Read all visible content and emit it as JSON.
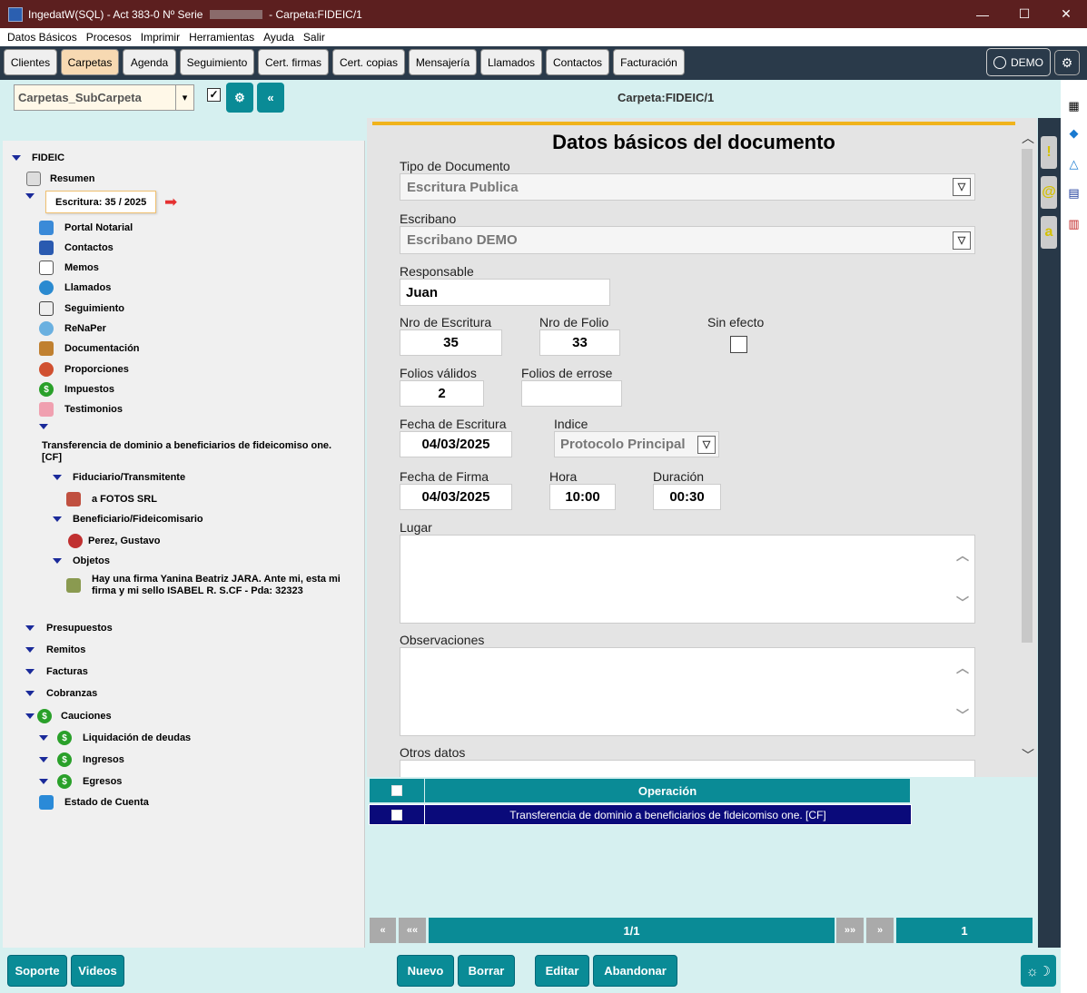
{
  "window": {
    "title_prefix": "IngedatW(SQL) - Act 383-0 Nº Serie",
    "title_suffix": "- Carpeta:FIDEIC/1",
    "controls": {
      "minimize": "—",
      "maximize": "☐",
      "close": "✕"
    }
  },
  "menu": [
    "Datos Básicos",
    "Procesos",
    "Imprimir",
    "Herramientas",
    "Ayuda",
    "Salir"
  ],
  "tabs": [
    {
      "label": "Clientes"
    },
    {
      "label": "Carpetas",
      "active": true
    },
    {
      "label": "Agenda"
    },
    {
      "label": "Seguimiento"
    },
    {
      "label": "Cert. firmas"
    },
    {
      "label": "Cert. copias"
    },
    {
      "label": "Mensajería"
    },
    {
      "label": "Llamados"
    },
    {
      "label": "Contactos"
    },
    {
      "label": "Facturación"
    }
  ],
  "user": {
    "label": "DEMO"
  },
  "toolbar": {
    "subfolder_select": "Carpetas_SubCarpeta",
    "checked": true,
    "collapse_label": "«",
    "folder_title": "Carpeta:FIDEIC/1"
  },
  "tree": {
    "root": "FIDEIC",
    "resumen": "Resumen",
    "escritura": "Escritura: 35 / 2025",
    "items": [
      "Portal Notarial",
      "Contactos",
      "Memos",
      "Llamados",
      "Seguimiento",
      "ReNaPer",
      "Documentación",
      "Proporciones",
      "Impuestos",
      "Testimonios"
    ],
    "operation": "Transferencia de dominio a beneficiarios de fideicomiso one. [CF]",
    "fiduciario_label": "Fiduciario/Transmitente",
    "fiduciario_value": "a FOTOS SRL",
    "beneficiario_label": "Beneficiario/Fideicomisario",
    "beneficiario_value": "Perez, Gustavo",
    "objetos_label": "Objetos",
    "objetos_value": "Hay una firma Yanina Beatriz JARA. Ante mi, esta mi firma y mi sello ISABEL R. S.CF - Pda: 32323",
    "bottom_items": [
      "Presupuestos",
      "Remitos",
      "Facturas",
      "Cobranzas",
      "Cauciones",
      "Liquidación de deudas",
      "Ingresos",
      "Egresos",
      "Estado de Cuenta"
    ]
  },
  "form": {
    "title": "Datos básicos del documento",
    "tipo_label": "Tipo de Documento",
    "tipo_value": "Escritura Publica",
    "escribano_label": "Escribano",
    "escribano_value": "Escribano DEMO",
    "responsable_label": "Responsable",
    "responsable_value": "Juan",
    "nro_escritura_label": "Nro de Escritura",
    "nro_escritura_value": "35",
    "nro_folio_label": "Nro de Folio",
    "nro_folio_value": "33",
    "sin_efecto_label": "Sin efecto",
    "folios_validos_label": "Folios válidos",
    "folios_validos_value": "2",
    "folios_errose_label": "Folios de errose",
    "folios_errose_value": "",
    "fecha_escritura_label": "Fecha de Escritura",
    "fecha_escritura_value": "04/03/2025",
    "indice_label": "Indice",
    "indice_value": "Protocolo Principal",
    "fecha_firma_label": "Fecha de Firma",
    "fecha_firma_value": "04/03/2025",
    "hora_label": "Hora",
    "hora_value": "10:00",
    "duracion_label": "Duración",
    "duracion_value": "00:30",
    "lugar_label": "Lugar",
    "observaciones_label": "Observaciones",
    "otros_label": "Otros datos"
  },
  "grid": {
    "header": "Operación",
    "row": "Transferencia de dominio a beneficiarios de fideicomiso one. [CF]",
    "page": "1/1",
    "count": "1",
    "nav": {
      "prev": "«",
      "first": "««",
      "last": "»»",
      "next": "»"
    }
  },
  "bottom": {
    "soporte": "Soporte",
    "videos": "Videos",
    "nuevo": "Nuevo",
    "borrar": "Borrar",
    "editar": "Editar",
    "abandonar": "Abandonar"
  },
  "colors": {
    "accent": "#0a8b96",
    "titlebar": "#5c1f1f",
    "active_tab": "#f7d9b2",
    "selected_row": "#0a0a7a",
    "gold": "#f0b31c"
  }
}
